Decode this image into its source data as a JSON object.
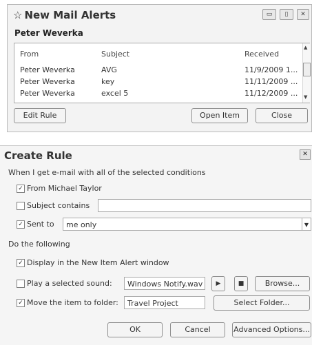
{
  "alerts_window": {
    "title": "New Mail Alerts",
    "sender": "Peter Weverka",
    "columns": [
      "From",
      "Subject",
      "Received"
    ],
    "rows": [
      {
        "from": "Peter Weverka",
        "subject": "AVG",
        "received": "11/9/2009 1..."
      },
      {
        "from": "Peter Weverka",
        "subject": "key",
        "received": "11/11/2009 ..."
      },
      {
        "from": "Peter Weverka",
        "subject": "excel 5",
        "received": "11/12/2009 ..."
      }
    ],
    "buttons": {
      "edit_rule": "Edit Rule",
      "open_item": "Open Item",
      "close": "Close"
    },
    "icons": {
      "title": "star-icon",
      "scroll_up": "scroll-up-icon",
      "scroll_down": "scroll-down-icon"
    }
  },
  "create_rule": {
    "title": "Create Rule",
    "conditions_heading": "When I get e-mail with all of the selected conditions",
    "conditions": {
      "from": {
        "label": "From Michael Taylor",
        "checked": true
      },
      "subject": {
        "label": "Subject contains",
        "checked": false,
        "value": ""
      },
      "sent_to": {
        "label": "Sent to",
        "checked": true,
        "value": "me only"
      }
    },
    "actions_heading": "Do the following",
    "actions": {
      "display": {
        "label": "Display in the New Item Alert window",
        "checked": true
      },
      "play_sound": {
        "label": "Play a selected sound:",
        "checked": false,
        "value": "Windows Notify.wav",
        "browse_label": "Browse..."
      },
      "move": {
        "label": "Move the item to folder:",
        "checked": true,
        "value": "Travel Project",
        "select_label": "Select Folder..."
      }
    },
    "footer": {
      "ok": "OK",
      "cancel": "Cancel",
      "advanced": "Advanced Options..."
    }
  }
}
